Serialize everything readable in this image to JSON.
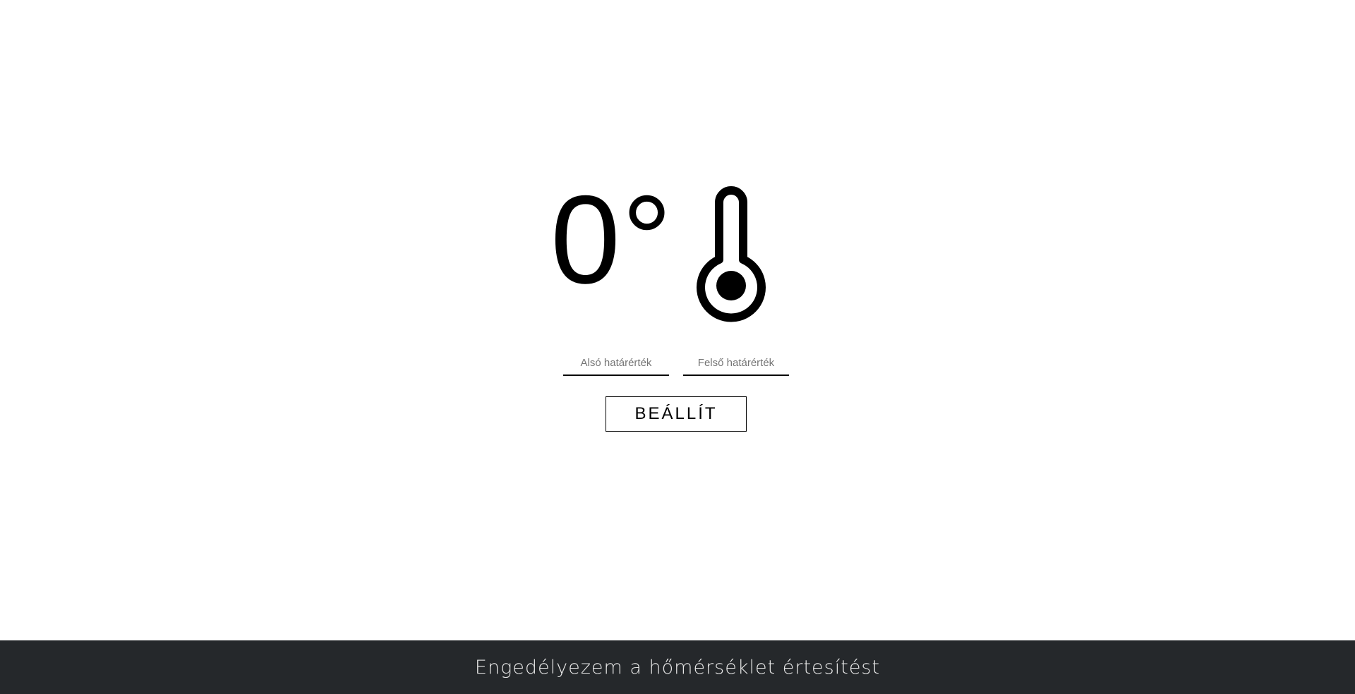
{
  "temperature": {
    "value": "0",
    "unit_symbol": "°"
  },
  "icons": {
    "thermometer": "thermometer-icon"
  },
  "limits": {
    "lower_placeholder": "Alsó határérték",
    "upper_placeholder": "Felső határérték",
    "lower_value": "",
    "upper_value": ""
  },
  "actions": {
    "set_label": "BEÁLLÍT"
  },
  "footer": {
    "notification_label": "Engedélyezem a hőmérséklet értesítést"
  },
  "colors": {
    "background": "#ffffff",
    "foreground": "#000000",
    "footer_background": "#25282b",
    "footer_text": "#e8e8e8"
  }
}
